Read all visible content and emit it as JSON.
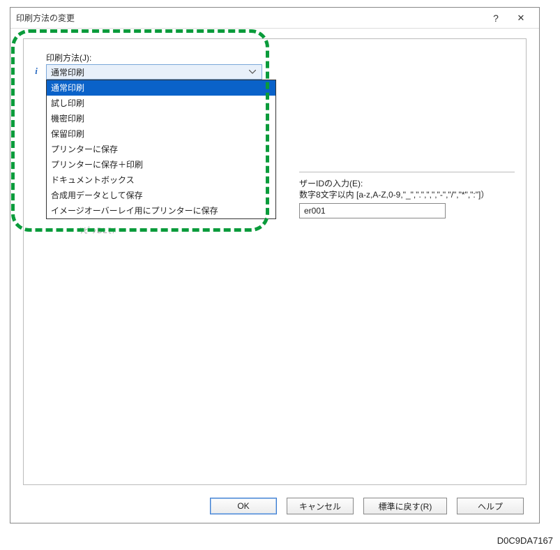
{
  "dialog": {
    "title": "印刷方法の変更"
  },
  "printMethod": {
    "label": "印刷方法(J):",
    "selected": "通常印刷",
    "options": [
      "通常印刷",
      "試し印刷",
      "機密印刷",
      "保留印刷",
      "プリンターに保存",
      "プリンターに保存＋印刷",
      "ドキュメントボックス",
      "合成用データとして保存",
      "イメージオーバーレイ用にプリンターに保存"
    ]
  },
  "userId": {
    "label": "ザーIDの入力(E):",
    "hint": "数字8文字以内 [a-z,A-Z,0-9,\"_\",\".\",\",\",\"-\",\"/\",\"*\",\":\"]）",
    "value": "er001"
  },
  "obscured": "ﾘﾋﾟﾝBLﾓﾒ",
  "buttons": {
    "ok": "OK",
    "cancel": "キャンセル",
    "reset": "標準に戻す(R)",
    "help": "ヘルプ"
  },
  "footer": {
    "id": "D0C9DA7167"
  }
}
